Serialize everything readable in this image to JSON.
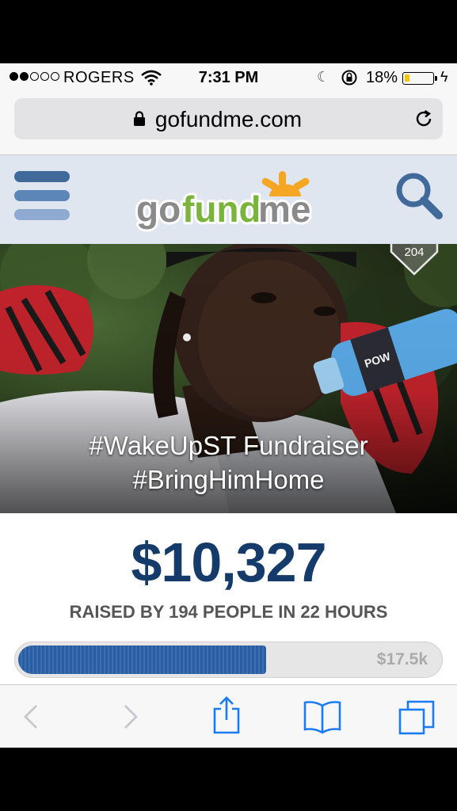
{
  "status_bar": {
    "carrier": "ROGERS",
    "signal_dots_filled": 2,
    "signal_dots_total": 5,
    "time": "7:31 PM",
    "battery_percent": "18%",
    "battery_level": 0.18,
    "battery_color": "#f5c400"
  },
  "url_bar": {
    "url": "gofundme.com",
    "lock_icon": "lock-icon",
    "reload_icon": "reload-icon"
  },
  "site_header": {
    "logo_text_go": "go",
    "logo_text_fund": "fund",
    "logo_text_me": "me",
    "menu_icon": "hamburger-menu-icon",
    "search_icon": "search-icon",
    "brand_blue": "#3f6a9a",
    "brand_green": "#7ab43a",
    "brand_orange": "#f5a623"
  },
  "hero": {
    "share_count": "204",
    "title_line1": "#WakeUpST Fundraiser",
    "title_line2": "#BringHimHome"
  },
  "campaign": {
    "amount_raised": "$10,327",
    "raised_by": "RAISED BY 194 PEOPLE IN 22 HOURS",
    "goal": "$17.5k",
    "progress_fraction": 0.59,
    "amount_color": "#143b6a"
  },
  "toolbar": {
    "back_icon": "back-arrow-icon",
    "forward_icon": "forward-arrow-icon",
    "share_icon": "share-icon",
    "bookmarks_icon": "bookmarks-icon",
    "tabs_icon": "tabs-icon"
  }
}
